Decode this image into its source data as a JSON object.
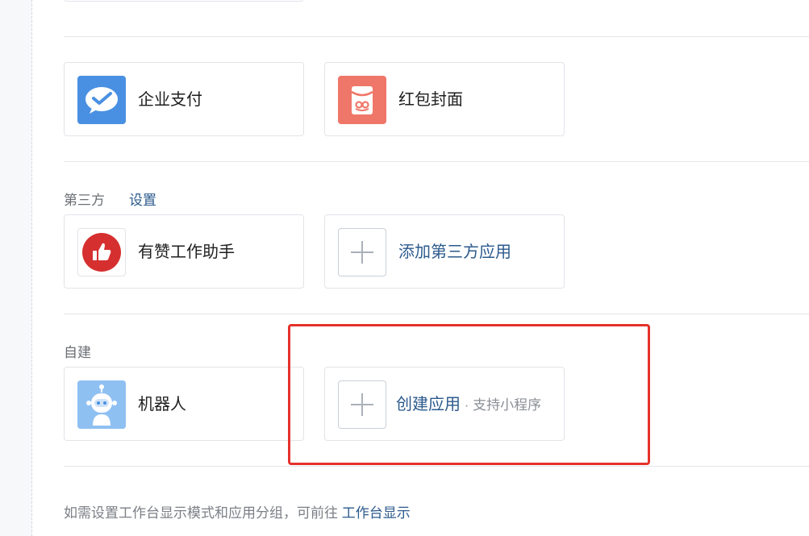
{
  "sections": {
    "payments": {
      "cards": [
        {
          "label": "企业支付",
          "icon": "wechat-pay-icon"
        },
        {
          "label": "红包封面",
          "icon": "red-packet-icon"
        }
      ]
    },
    "third_party": {
      "title": "第三方",
      "settings_link": "设置",
      "cards": [
        {
          "label": "有赞工作助手",
          "icon": "thumbs-up-icon"
        },
        {
          "label": "添加第三方应用",
          "icon": "plus-icon"
        }
      ]
    },
    "self_built": {
      "title": "自建",
      "cards": [
        {
          "label": "机器人",
          "icon": "robot-icon"
        },
        {
          "label": "创建应用",
          "sub": " · 支持小程序",
          "icon": "plus-icon"
        }
      ]
    }
  },
  "footer": {
    "text": "如需设置工作台显示模式和应用分组，可前往 ",
    "link": "工作台显示"
  },
  "colors": {
    "accent_link": "#2b5a8c",
    "highlight": "#e5312b",
    "wechat_blue": "#4a90e2",
    "red_packet": "#ef7769",
    "youzan_red": "#d62f2f"
  }
}
